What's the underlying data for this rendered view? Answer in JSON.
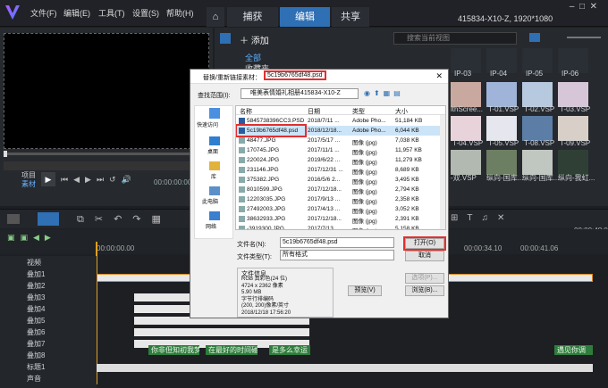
{
  "app": {
    "brand_icon": "logo-v",
    "menus": [
      "文件(F)",
      "编辑(E)",
      "工具(T)",
      "设置(S)",
      "帮助(H)"
    ],
    "tabs": [
      "捕获",
      "编辑",
      "共享"
    ],
    "active_tab": "编辑",
    "project_info": "415834-X10-Z, 1920*1080"
  },
  "library": {
    "add_label": "添加",
    "categories": [
      "全部",
      "收藏夹"
    ],
    "search_placeholder": "搜索当前视图",
    "thumb_labels": [
      "IP-03",
      "IP-04",
      "IP-05",
      "IP-06",
      "lthScree...",
      "T-01.VSP",
      "T-02.VSP",
      "T-03.VSP",
      "T-04.VSP",
      "T-05.VSP",
      "T-08.VSP",
      "T-09.VSP",
      "-双.VSP",
      "纵向-国库...",
      "纵向-国库...",
      "纵向-我虹..."
    ]
  },
  "player": {
    "mode_project": "项目",
    "mode_clip": "素材",
    "timecode": "00:00:00:00",
    "zoom_time": "00:00:48:06"
  },
  "ruler": {
    "t0": "00:00:00.00",
    "t1": "00:00:34.10",
    "t2": "00:00:41.06"
  },
  "tracks": [
    "视频",
    "叠加1",
    "叠加2",
    "叠加3",
    "叠加4",
    "叠加5",
    "叠加6",
    "叠加7",
    "叠加8",
    "标题1",
    "声音"
  ],
  "subtitles": [
    "你非但知初我梦",
    "在最好的时间碰",
    "是多么幸运",
    "遇见你调"
  ],
  "dialog": {
    "title_prefix": "替换/重新链接素材：",
    "title_file": "5c19b6765df48.psd",
    "lookin_label": "查找范围(I):",
    "lookin_value": "唯美表情婚礼相册415834-X10-Z",
    "places": [
      "快速访问",
      "桌面",
      "库",
      "此电脑",
      "网络"
    ],
    "columns": [
      "名称",
      "日期",
      "类型",
      "大小"
    ],
    "files": [
      [
        "5845738396CC3.PSD",
        "2018/7/11 ...",
        "Adobe Pho...",
        "51,184 KB"
      ],
      [
        "5c19b6765df48.psd",
        "2018/12/18...",
        "Adobe Pho...",
        "6,044 KB"
      ],
      [
        "48477.JPG",
        "2017/5/17 ...",
        "图像 (jpg)",
        "7,038 KB"
      ],
      [
        "170745.JPG",
        "2017/11/1 ...",
        "图像 (jpg)",
        "11,957 KB"
      ],
      [
        "220024.JPG",
        "2019/6/22 ...",
        "图像 (jpg)",
        "11,279 KB"
      ],
      [
        "231146.JPG",
        "2017/12/31 ...",
        "图像 (jpg)",
        "8,689 KB"
      ],
      [
        "375382.JPG",
        "2016/5/6 2...",
        "图像 (jpg)",
        "3,495 KB"
      ],
      [
        "8010599.JPG",
        "2017/12/18...",
        "图像 (jpg)",
        "2,794 KB"
      ],
      [
        "12203035.JPG",
        "2017/9/13 ...",
        "图像 (jpg)",
        "2,358 KB"
      ],
      [
        "27492003.JPG",
        "2017/4/13 ...",
        "图像 (jpg)",
        "3,052 KB"
      ],
      [
        "38632933.JPG",
        "2017/12/18...",
        "图像 (jpg)",
        "2,391 KB"
      ],
      [
        "-3919300.JPG",
        "2017/7/13 ...",
        "图像 (jpg)",
        "5,158 KB"
      ]
    ],
    "filename_label": "文件名(N):",
    "filename_value": "5c19b6765df48.psd",
    "filetype_label": "文件类型(T):",
    "filetype_value": "所有格式",
    "open_btn": "打开(O)",
    "cancel_btn": "取消",
    "info_title": "文件信息",
    "info_lines": [
      "RGB 真彩色(24 位)",
      "4724 x 2362 像素",
      "5.90 MB",
      "字节行排编码",
      "(200, 200)像素/英寸",
      "2018/12/18  17:56:20"
    ],
    "preview_btn": "预览(V)",
    "options_btn": "选项(P)...",
    "browse_btn": "浏览(B)..."
  }
}
